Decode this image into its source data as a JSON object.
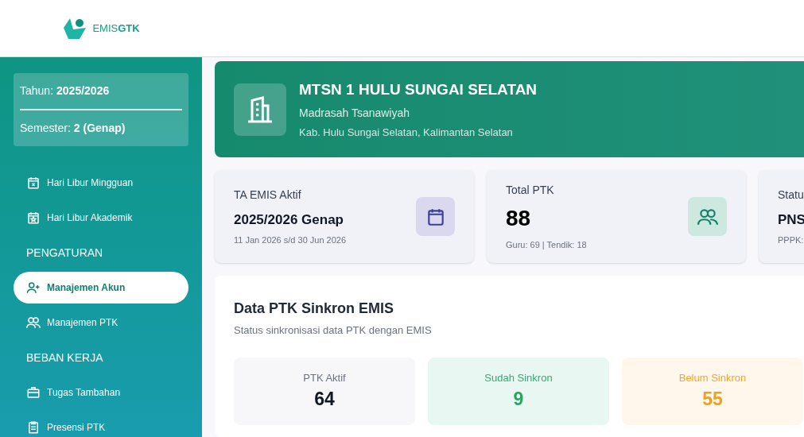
{
  "logo": {
    "text_regular": "EMIS",
    "text_bold": "GTK"
  },
  "sidebar": {
    "period": [
      {
        "label": "Tahun:",
        "value": "2025/2026"
      },
      {
        "label": "Semester:",
        "value": "2 (Genap)"
      }
    ],
    "items": [
      {
        "kind": "item",
        "label": "Hari Libur Mingguan",
        "selected": false
      },
      {
        "kind": "item",
        "label": "Hari Libur Akademik",
        "selected": false
      },
      {
        "kind": "header",
        "label": "PENGATURAN"
      },
      {
        "kind": "item",
        "label": "Manajemen Akun",
        "selected": true
      },
      {
        "kind": "item",
        "label": "Manajemen PTK",
        "selected": false
      },
      {
        "kind": "header",
        "label": "BEBAN KERJA"
      },
      {
        "kind": "item",
        "label": "Tugas Tambahan",
        "selected": false
      },
      {
        "kind": "item",
        "label": "Presensi PTK",
        "selected": false
      }
    ]
  },
  "banner": {
    "title": "MTSN 1 HULU SUNGAI SELATAN",
    "subtitle": "Madrasah Tsanawiyah",
    "location": "Kab. Hulu Sungai Selatan, Kalimantan Selatan"
  },
  "stat_cards": [
    {
      "label": "TA EMIS Aktif",
      "value": "2025/2026 Genap",
      "note": "11 Jan 2026 s/d 30 Jun 2026",
      "kind": "calendar"
    },
    {
      "label": "Total PTK",
      "value": "88",
      "note": "Guru: 69 | Tendik: 18",
      "kind": "people"
    },
    {
      "label": "Statu",
      "value": "PNS",
      "note": "PPPK:",
      "kind": "partial"
    }
  ],
  "sync": {
    "title": "Data PTK Sinkron EMIS",
    "subtitle": "Status sinkronisasi data PTK dengan EMIS",
    "stats": [
      {
        "label": "PTK Aktif",
        "value": "64",
        "kind": "neutral"
      },
      {
        "label": "Sudah Sinkron",
        "value": "9",
        "kind": "success"
      },
      {
        "label": "Belum Sinkron",
        "value": "55",
        "kind": "warning"
      }
    ]
  }
}
